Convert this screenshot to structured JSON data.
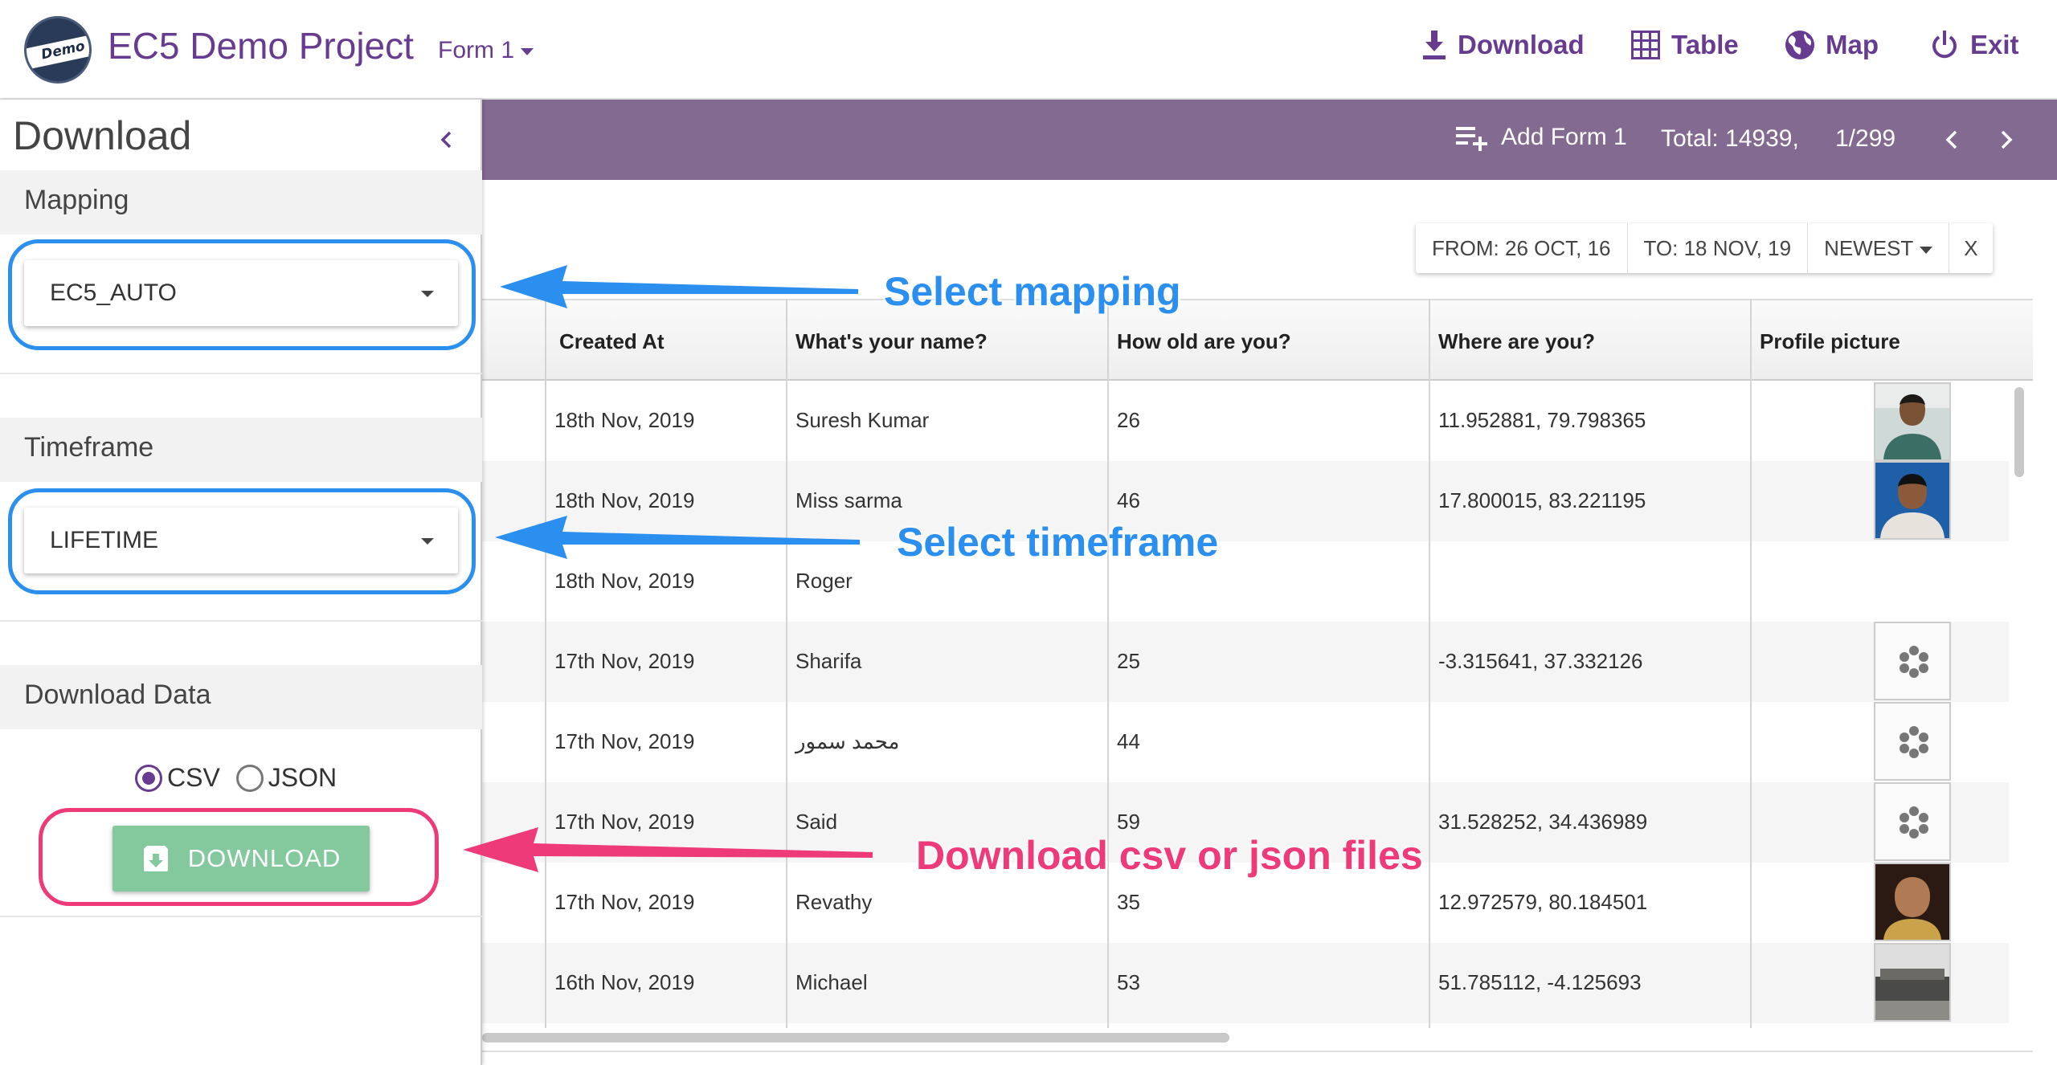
{
  "header": {
    "logo_text": "Demo",
    "project_title": "EC5 Demo Project",
    "form_select": "Form 1",
    "nav": [
      {
        "label": "Download",
        "icon": "download-icon"
      },
      {
        "label": "Table",
        "icon": "table-icon"
      },
      {
        "label": "Map",
        "icon": "globe-icon"
      },
      {
        "label": "Exit",
        "icon": "power-icon"
      }
    ]
  },
  "toolbar": {
    "add_label": "Add Form 1",
    "total": "Total: 14939,",
    "pager": "1/299"
  },
  "filters": {
    "from": "FROM: 26 OCT, 16",
    "to": "TO: 18 NOV, 19",
    "sort": "NEWEST",
    "clear": "X"
  },
  "table": {
    "headers": [
      "Created At",
      "What's your name?",
      "How old are you?",
      "Where are you?",
      "Profile picture"
    ],
    "rows": [
      {
        "created": "18th Nov, 2019",
        "name": "Suresh Kumar",
        "age": "26",
        "where": "11.952881, 79.798365",
        "picture": "photo"
      },
      {
        "created": "18th Nov, 2019",
        "name": "Miss sarma",
        "age": "46",
        "where": "17.800015, 83.221195",
        "picture": "photo"
      },
      {
        "created": "18th Nov, 2019",
        "name": "Roger",
        "age": "",
        "where": "",
        "picture": "none"
      },
      {
        "created": "17th Nov, 2019",
        "name": "Sharifa",
        "age": "25",
        "where": "-3.315641, 37.332126",
        "picture": "loading"
      },
      {
        "created": "17th Nov, 2019",
        "name": "محمد سمور",
        "age": "44",
        "where": "",
        "picture": "loading"
      },
      {
        "created": "17th Nov, 2019",
        "name": "Said",
        "age": "59",
        "where": "31.528252, 34.436989",
        "picture": "loading"
      },
      {
        "created": "17th Nov, 2019",
        "name": "Revathy",
        "age": "35",
        "where": "12.972579, 80.184501",
        "picture": "photo"
      },
      {
        "created": "16th Nov, 2019",
        "name": "Michael",
        "age": "53",
        "where": "51.785112, -4.125693",
        "picture": "photo"
      }
    ]
  },
  "panel": {
    "title": "Download",
    "mapping_heading": "Mapping",
    "mapping_value": "EC5_AUTO",
    "timeframe_heading": "Timeframe",
    "timeframe_value": "LIFETIME",
    "download_heading": "Download Data",
    "format_options": [
      "CSV",
      "JSON"
    ],
    "format_selected": "CSV",
    "download_button": "DOWNLOAD"
  },
  "annotations": {
    "mapping": "Select mapping",
    "timeframe": "Select timeframe",
    "download": "Download csv or json files"
  },
  "colors": {
    "brand_purple": "#673c90",
    "toolbar_purple": "#836a91",
    "download_green": "#84c99e",
    "annotation_blue": "#2b8ff0",
    "annotation_pink": "#ee3a79"
  }
}
